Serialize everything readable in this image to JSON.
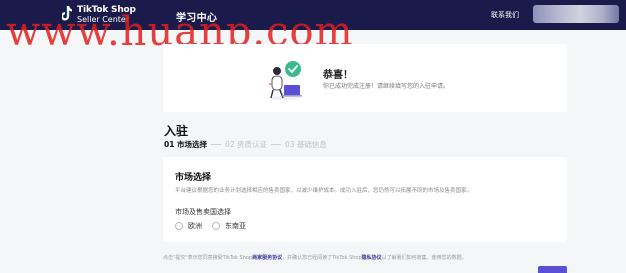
{
  "header": {
    "logo_line1": "TikTok Shop",
    "logo_line2": "Seller Center",
    "nav_link": "学习中心",
    "contact_link": "联系我们"
  },
  "watermark": "www.huanp.com",
  "success": {
    "title": "恭喜！",
    "description": "你已成功完成注册！请继续填写您的入驻申请。"
  },
  "page": {
    "title": "入驻",
    "steps": [
      {
        "label": "01 市场选择",
        "active": true
      },
      {
        "label": "02 资质认证",
        "active": false
      },
      {
        "label": "03 基础信息",
        "active": false
      }
    ]
  },
  "market": {
    "title": "市场选择",
    "description": "平台建议根据您的业务计划选择相应的售卖国家，以减少维护成本。成功入驻后，您仍然可以拓展不同的市场及售卖国家。",
    "field_label": "市场及售卖国选择",
    "options": [
      "欧洲",
      "东南亚"
    ]
  },
  "footer": {
    "prefix": "点击\"提交\"表示您同意接受TikTok Shop",
    "link1": "商家服务协议",
    "middle": "，并确认您已经阅读了TikTok Shop",
    "link2": "隐私协议",
    "suffix": "以了解我们如何收集、使用您的数据。"
  },
  "colors": {
    "header_bg": "#1b1b4b",
    "accent": "#5b4fd8",
    "success_green": "#3ab98a",
    "watermark_red": "#e01e1e"
  }
}
